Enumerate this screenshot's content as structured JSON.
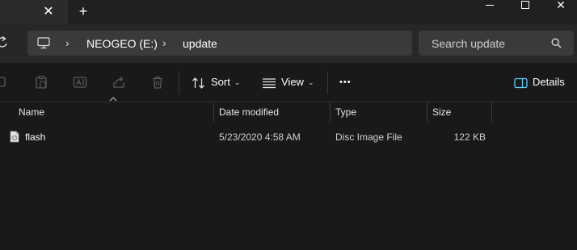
{
  "window": {
    "new_tab_symbol": "+",
    "close_tab_symbol": "✕"
  },
  "address": {
    "crumbs": [
      "NEOGEO (E:)",
      "update"
    ]
  },
  "search": {
    "placeholder": "Search update"
  },
  "toolbar": {
    "sort_label": "Sort",
    "view_label": "View",
    "more_label": "•••",
    "details_label": "Details"
  },
  "columns": [
    "Name",
    "Date modified",
    "Type",
    "Size"
  ],
  "files": [
    {
      "name": "flash",
      "date_modified": "5/23/2020 4:58 AM",
      "type": "Disc Image File",
      "size": "122 KB"
    }
  ],
  "colors": {
    "background": "#191919",
    "titlebar": "#202020",
    "navrow": "#272727",
    "field": "#3a3a3a",
    "accent": "#60cdff"
  }
}
